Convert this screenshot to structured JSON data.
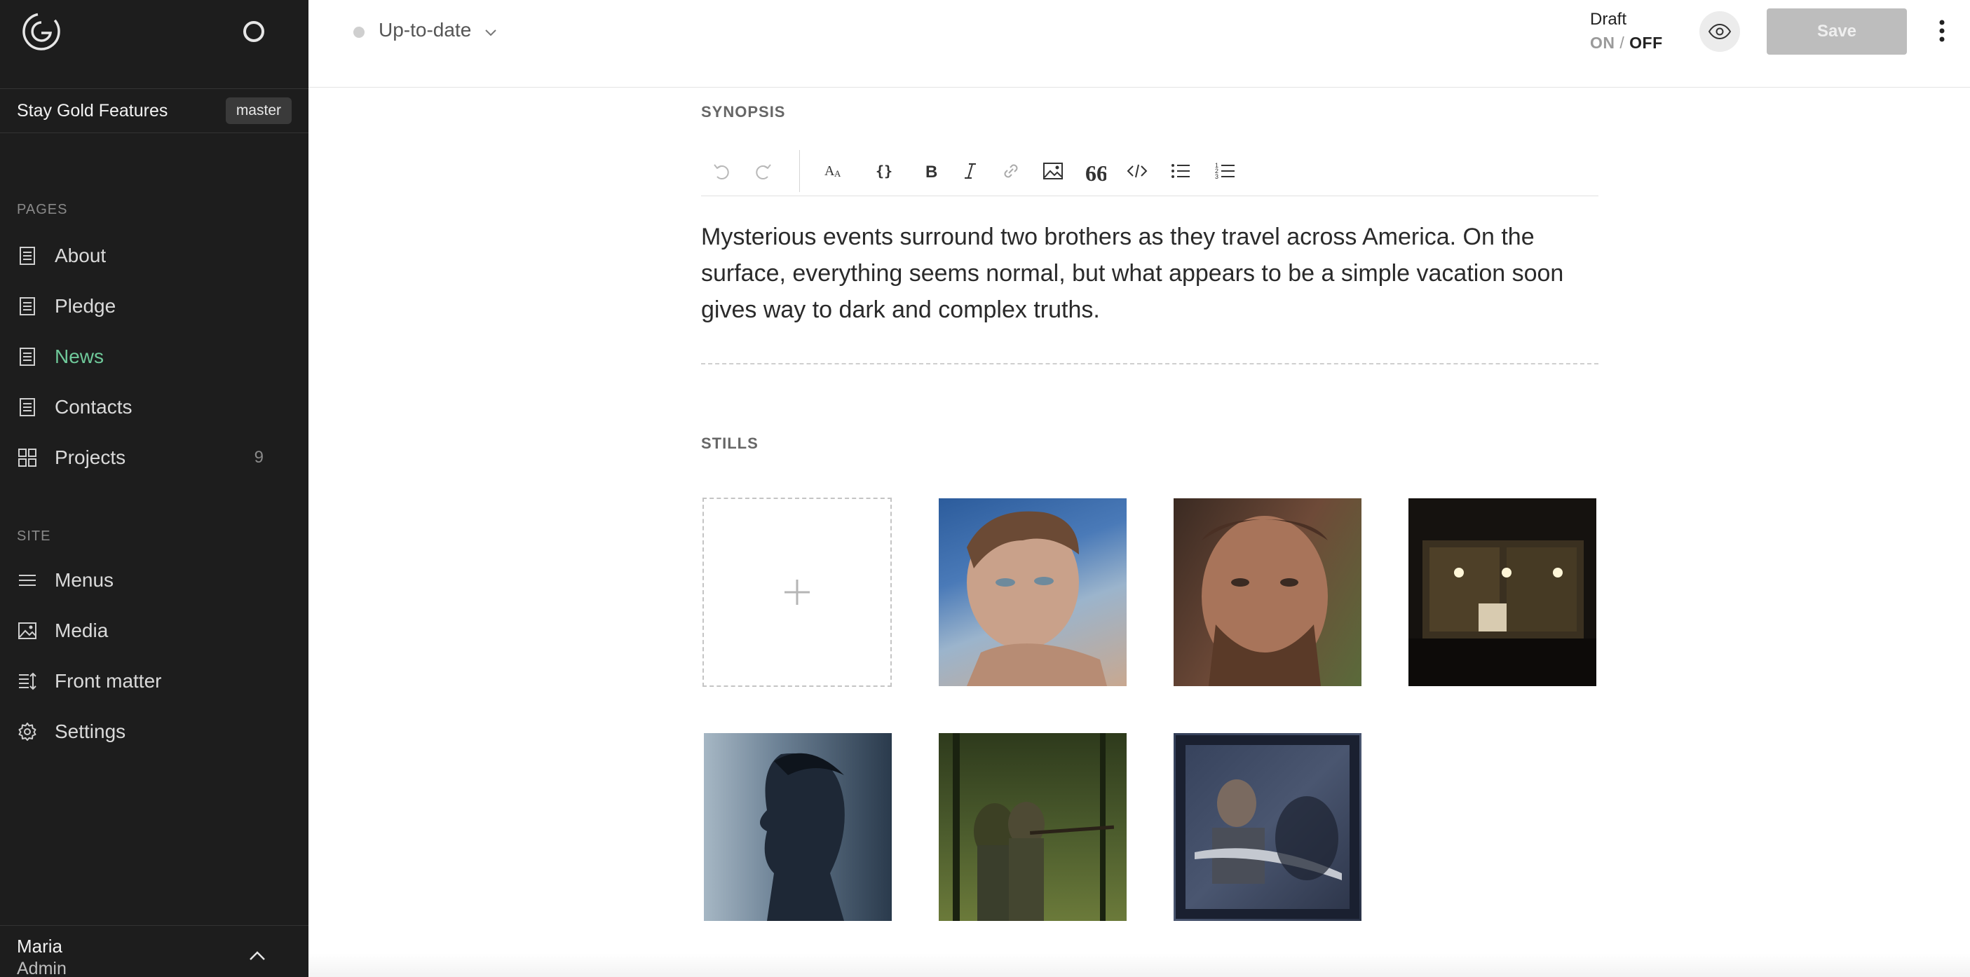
{
  "sidebar": {
    "project_name": "Stay Gold Features",
    "branch": "master",
    "pages_label": "PAGES",
    "pages": [
      {
        "label": "About",
        "icon": "page-icon",
        "active": false
      },
      {
        "label": "Pledge",
        "icon": "page-icon",
        "active": false
      },
      {
        "label": "News",
        "icon": "page-icon",
        "active": true
      },
      {
        "label": "Contacts",
        "icon": "page-icon",
        "active": false
      },
      {
        "label": "Projects",
        "icon": "grid-icon",
        "count": "9",
        "active": false
      }
    ],
    "site_label": "SITE",
    "site": [
      {
        "label": "Menus",
        "icon": "menu-icon"
      },
      {
        "label": "Media",
        "icon": "image-icon"
      },
      {
        "label": "Front matter",
        "icon": "front-matter-icon"
      },
      {
        "label": "Settings",
        "icon": "gear-icon"
      }
    ],
    "user": {
      "name": "Maria",
      "role": "Admin"
    }
  },
  "topbar": {
    "status": "Up-to-date",
    "draft_label": "Draft",
    "draft_on": "ON",
    "draft_sep": "/",
    "draft_off": "OFF",
    "save_label": "Save"
  },
  "content": {
    "synopsis_label": "SYNOPSIS",
    "synopsis_text": "Mysterious events surround two brothers as they travel across America. On the surface, everything seems normal, but what appears to be a simple vacation soon gives way to dark and complex truths.",
    "stills_label": "STILLS",
    "toolbar": [
      "undo-icon",
      "redo-icon",
      "text-size-icon",
      "code-braces-icon",
      "bold-icon",
      "italic-icon",
      "link-icon",
      "image-icon",
      "quote-icon",
      "code-icon",
      "bullet-list-icon",
      "numbered-list-icon"
    ],
    "stills_count": 6
  },
  "colors": {
    "sidebar_bg": "#1d1d1d",
    "active_accent": "#6fc99a",
    "save_disabled": "#bdbdbd"
  }
}
